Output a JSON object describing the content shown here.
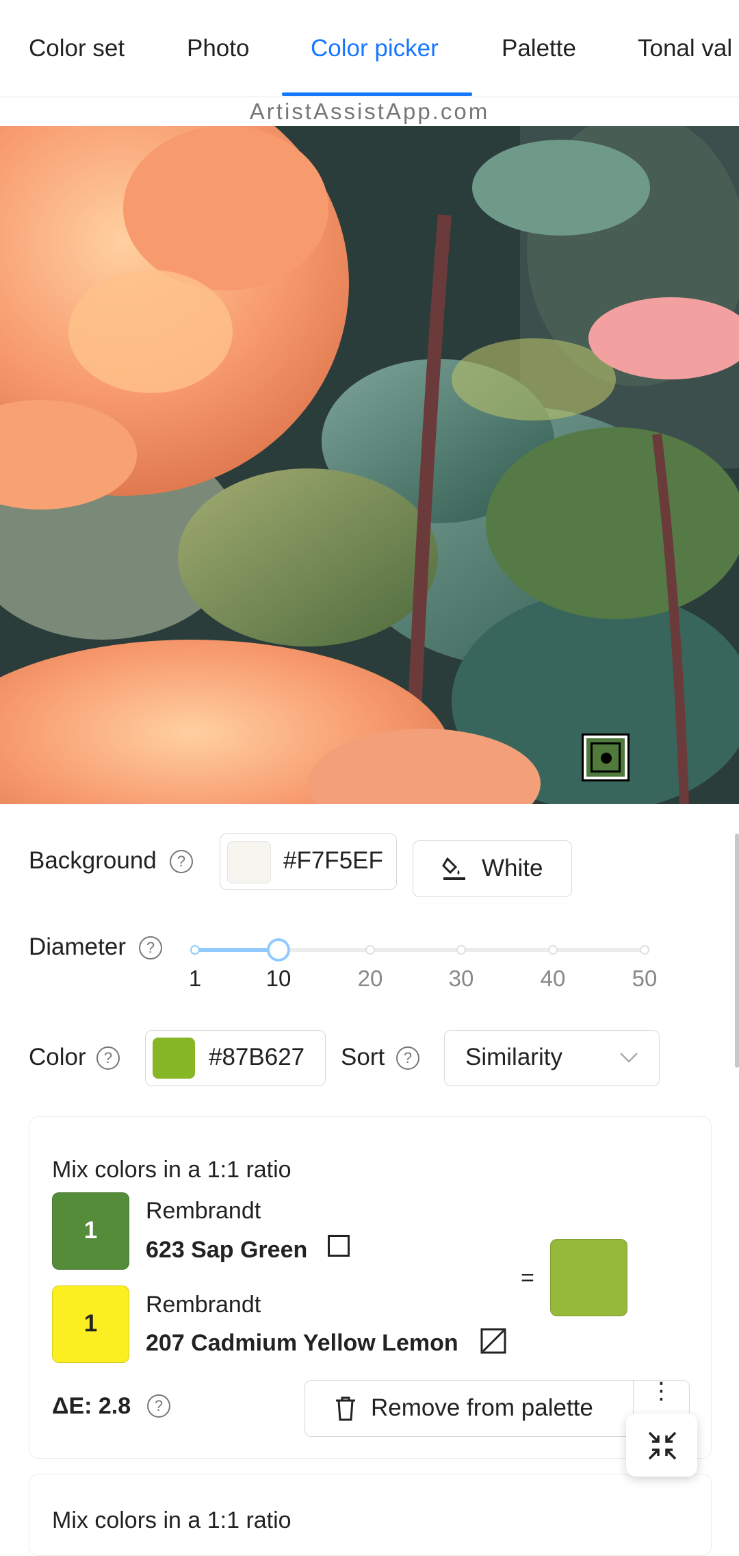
{
  "tabs": {
    "items": [
      "Color set",
      "Photo",
      "Color picker",
      "Palette",
      "Tonal val"
    ],
    "active": "Color picker"
  },
  "watermark": "ArtistAssistApp.com",
  "background": {
    "label": "Background",
    "value": "#F7F5EF",
    "swatch_color": "#F7F5EF",
    "white_button": "White"
  },
  "diameter": {
    "label": "Diameter",
    "ticks": [
      "1",
      "10",
      "20",
      "30",
      "40",
      "50"
    ],
    "value": 10
  },
  "color": {
    "label": "Color",
    "value": "#87B627",
    "swatch_color": "#87B627"
  },
  "sort": {
    "label": "Sort",
    "selected": "Similarity"
  },
  "mix_card": {
    "title": "Mix colors in a 1:1 ratio",
    "colors": [
      {
        "parts": "1",
        "brand": "Rembrandt",
        "name": "623 Sap Green",
        "swatch": "#548c3a",
        "opacity": "opaque"
      },
      {
        "parts": "1",
        "brand": "Rembrandt",
        "name": "207 Cadmium Yellow Lemon",
        "swatch": "#fbef21",
        "opacity": "semi-opaque"
      }
    ],
    "equals": "=",
    "result_swatch": "#96b83b",
    "delta_e": "ΔE: 2.8",
    "remove_button": "Remove from palette",
    "more_button": "⋮"
  },
  "next_card": {
    "title": "Mix colors in a 1:1 ratio"
  }
}
